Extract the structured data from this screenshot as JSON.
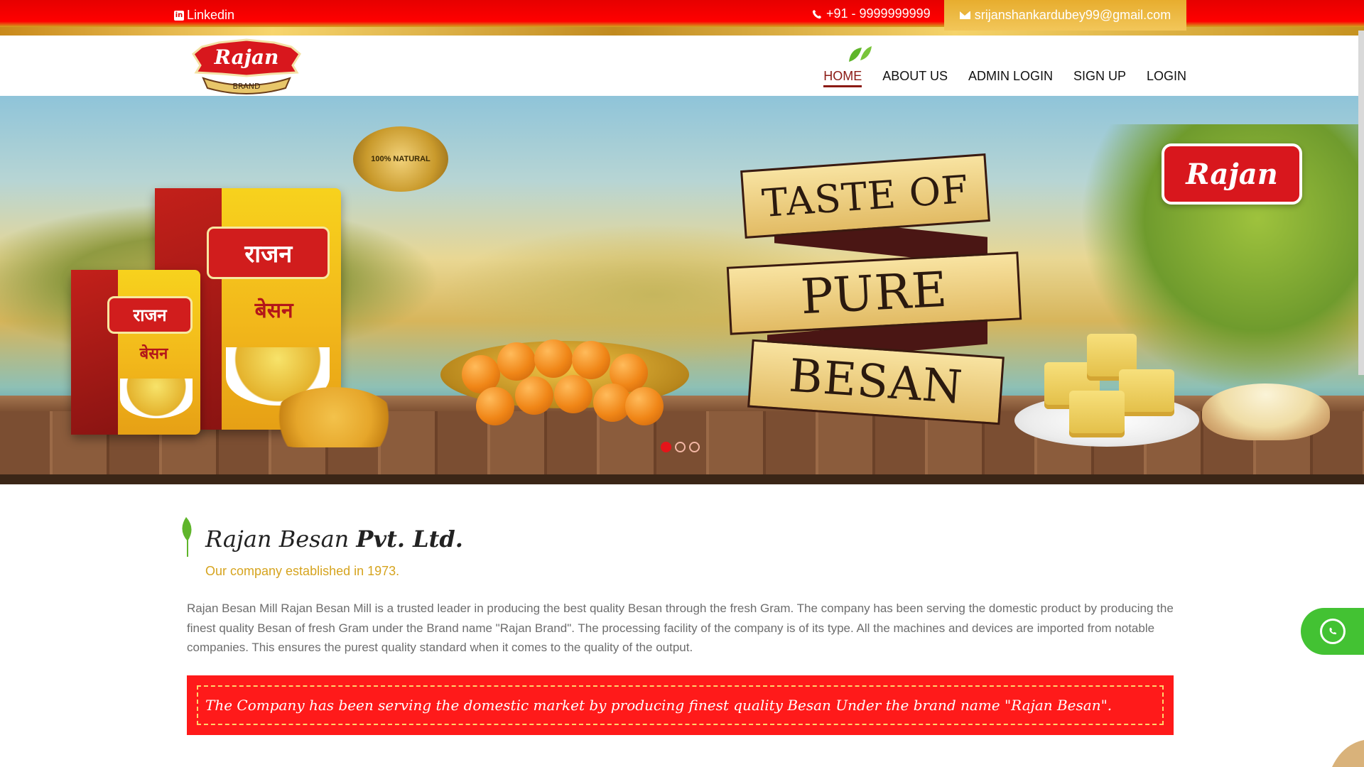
{
  "topbar": {
    "linkedin_label": "Linkedin",
    "linkedin_icon": "linkedin-icon",
    "phone": "+91 - 9999999999",
    "phone_icon": "phone-icon",
    "email": "srijanshankardubey99@gmail.com",
    "email_icon": "envelope-icon"
  },
  "logo": {
    "brand": "Rajan",
    "sub": "BRAND"
  },
  "nav": {
    "items": [
      {
        "label": "HOME",
        "active": true
      },
      {
        "label": "ABOUT US",
        "active": false
      },
      {
        "label": "ADMIN LOGIN",
        "active": false
      },
      {
        "label": "SIGN UP",
        "active": false
      },
      {
        "label": "LOGIN",
        "active": false
      }
    ]
  },
  "hero": {
    "banner_line1": "TASTE OF",
    "banner_line2": "PURE",
    "banner_line3": "BESAN",
    "seal_text": "100% NATURAL",
    "badge_text": "Rajan",
    "pack_brand": "राजन",
    "pack_product": "बेसन",
    "slides": 3,
    "active_slide": 1
  },
  "company": {
    "title_regular": "Rajan Besan ",
    "title_bold": "Pvt. Ltd.",
    "established": "Our company established in 1973.",
    "about": "Rajan Besan Mill Rajan Besan Mill is a trusted leader in producing the best quality Besan through the fresh Gram. The company has been serving the domestic product by producing the finest quality Besan of fresh Gram under the Brand name \"Rajan Brand\". The processing facility of the company is of its type. All the machines and devices are imported from notable companies. This ensures the purest quality standard when it comes to the quality of the output.",
    "quote": "The Company has been serving the domestic market by producing finest quality Besan Under the brand name \"Rajan Besan\"."
  },
  "colors": {
    "primary_red": "#e60000",
    "gold": "#e7ad2e",
    "accent_leaf": "#5fb52b",
    "whatsapp_green": "#43c233"
  }
}
